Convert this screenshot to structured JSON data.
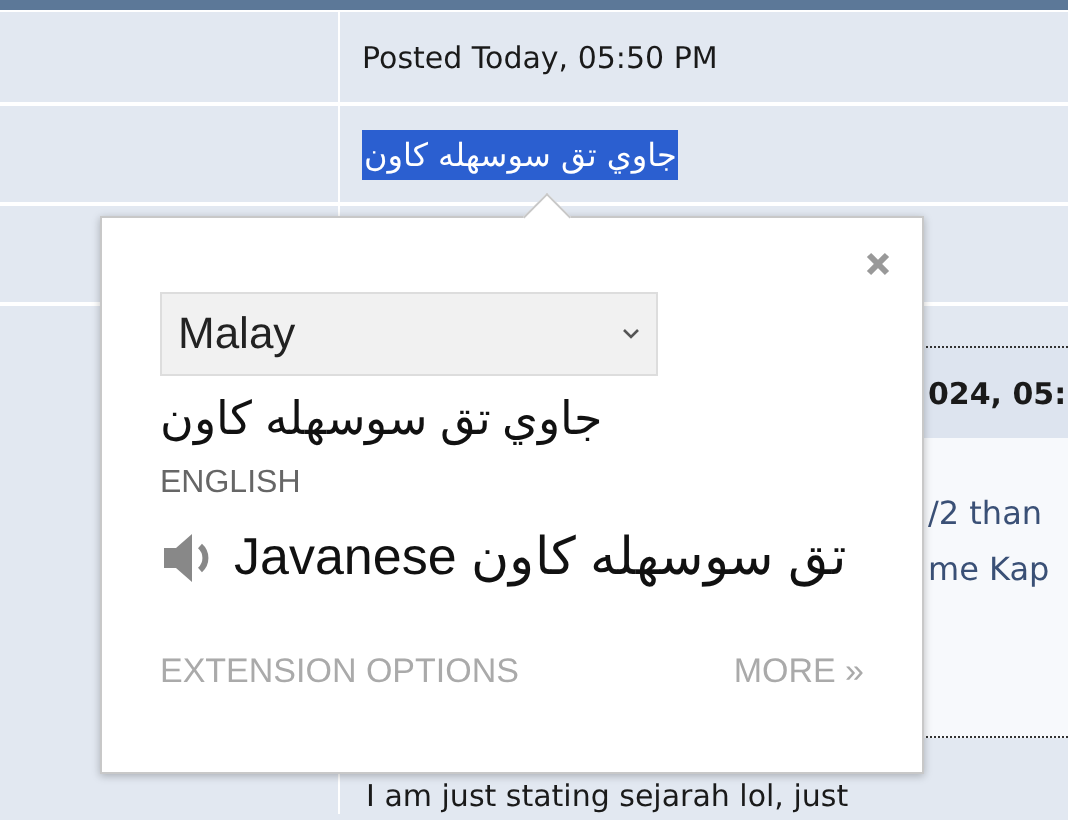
{
  "thread": {
    "posted": "Posted Today, 05:50 PM",
    "selected_text": "جاوي تق سوسهله كاون",
    "header_fragment": "024, 05:",
    "body_fragments": [
      "/2 than",
      "me Kap"
    ],
    "next_line": "I am just stating sejarah lol, just"
  },
  "popup": {
    "language": "Malay",
    "source_text": "جاوي تق سوسهله كاون",
    "target_label": "ENGLISH",
    "translation": "Javanese تق سوسهله كاون",
    "options_link": "EXTENSION OPTIONS",
    "more_link": "MORE »"
  }
}
